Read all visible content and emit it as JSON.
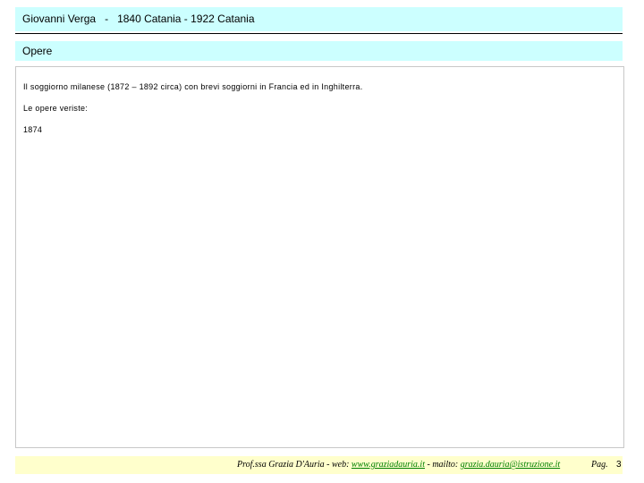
{
  "header": {
    "author": "Giovanni Verga",
    "separator": "-",
    "dates": "1840 Catania - 1922 Catania"
  },
  "section": {
    "title": "Opere"
  },
  "content": {
    "lines": [
      "Il soggiorno milanese (1872 – 1892 circa) con brevi soggiorni in Francia ed in Inghilterra.",
      "Le opere veriste:",
      "1874"
    ]
  },
  "footer": {
    "credit": "Prof.ssa Grazia D'Auria",
    "sep1": "-",
    "web_label": "web:",
    "web_link": "www.graziadauria.it",
    "sep2": "-",
    "mail_label": "mailto:",
    "mail_link": "grazia.dauria@istruzione.it",
    "page_label": "Pag.",
    "page_number": "3"
  },
  "colors": {
    "header_bg": "#ccffff",
    "footer_bg": "#ffffcc",
    "link": "#008000"
  }
}
